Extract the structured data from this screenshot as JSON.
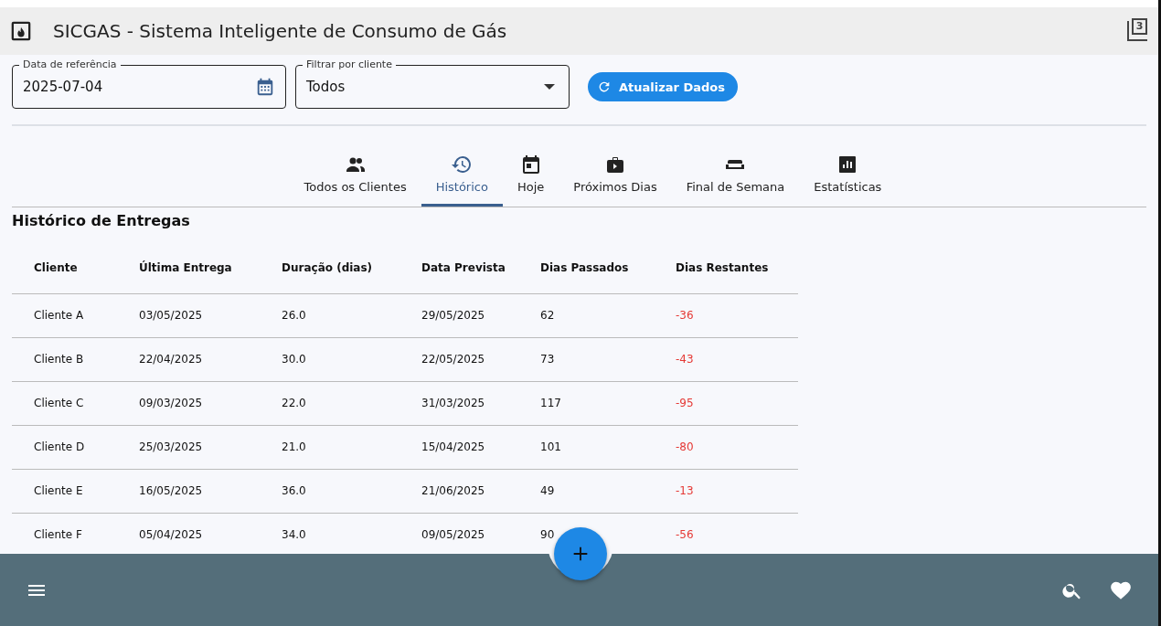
{
  "app_bar": {
    "title": "SICGAS - Sistema Inteligente de Consumo de Gás",
    "counter_icon_digit": "3"
  },
  "filters": {
    "date": {
      "label": "Data de referência",
      "value": "2025-07-04"
    },
    "client": {
      "label": "Filtrar por cliente",
      "value": "Todos"
    },
    "refresh_button": "Atualizar Dados"
  },
  "tabs": [
    {
      "label": "Todos os Clientes",
      "selected": false
    },
    {
      "label": "Histórico",
      "selected": true
    },
    {
      "label": "Hoje",
      "selected": false
    },
    {
      "label": "Próximos Dias",
      "selected": false
    },
    {
      "label": "Final de Semana",
      "selected": false
    },
    {
      "label": "Estatísticas",
      "selected": false
    }
  ],
  "section_title": "Histórico de Entregas",
  "table": {
    "columns": [
      "Cliente",
      "Última Entrega",
      "Duração (dias)",
      "Data Prevista",
      "Dias Passados",
      "Dias Restantes"
    ],
    "rows": [
      {
        "cells": [
          "Cliente A",
          "03/05/2025",
          "26.0",
          "29/05/2025",
          "62",
          "-36"
        ],
        "overdue": true
      },
      {
        "cells": [
          "Cliente B",
          "22/04/2025",
          "30.0",
          "22/05/2025",
          "73",
          "-43"
        ],
        "overdue": true
      },
      {
        "cells": [
          "Cliente C",
          "09/03/2025",
          "22.0",
          "31/03/2025",
          "117",
          "-95"
        ],
        "overdue": true
      },
      {
        "cells": [
          "Cliente D",
          "25/03/2025",
          "21.0",
          "15/04/2025",
          "101",
          "-80"
        ],
        "overdue": true
      },
      {
        "cells": [
          "Cliente E",
          "16/05/2025",
          "36.0",
          "21/06/2025",
          "49",
          "-13"
        ],
        "overdue": true
      },
      {
        "cells": [
          "Cliente F",
          "05/04/2025",
          "34.0",
          "09/05/2025",
          "90",
          "-56"
        ],
        "overdue": true
      }
    ]
  }
}
